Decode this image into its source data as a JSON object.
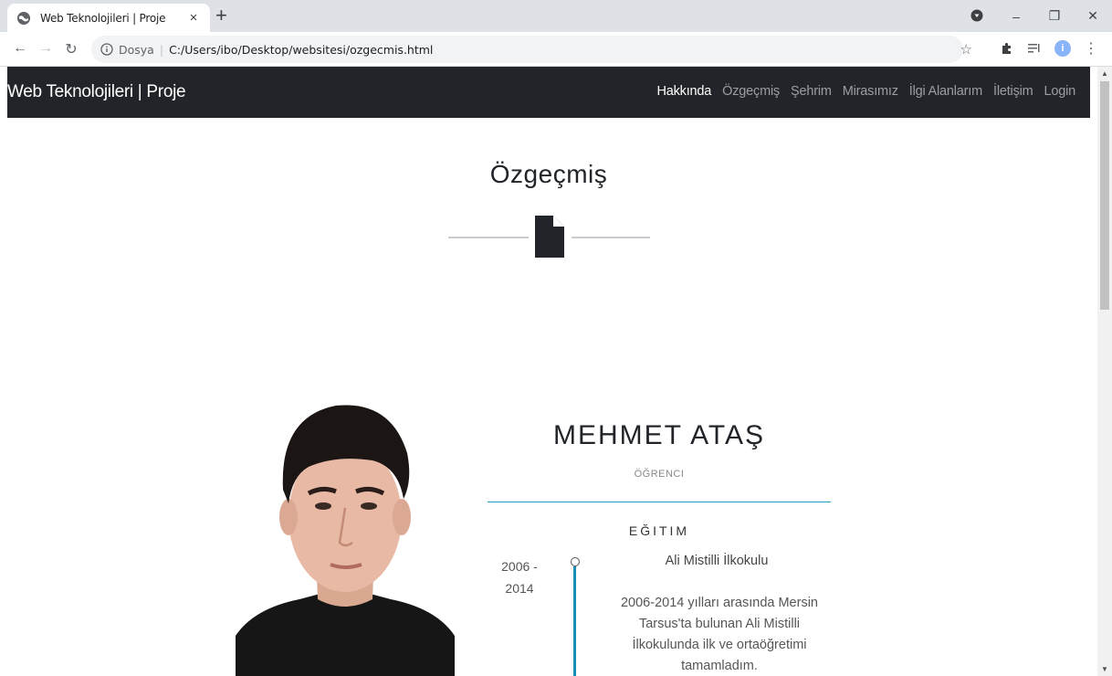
{
  "browser": {
    "tab_title": "Web Teknolojileri | Proje",
    "tab_close": "×",
    "new_tab": "+",
    "address_scheme": "Dosya",
    "address_url": "C:/Users/ibo/Desktop/websitesi/ozgecmis.html",
    "avatar_letter": "i"
  },
  "navbar": {
    "brand": "Web Teknolojileri | Proje",
    "links": [
      "Hakkında",
      "Özgeçmiş",
      "Şehrim",
      "Mirasımız",
      "İlgi Alanlarım",
      "İletişim",
      "Login"
    ]
  },
  "section": {
    "title": "Özgeçmiş"
  },
  "profile": {
    "name": "MEHMET ATAŞ",
    "role": "ÖĞRENCI"
  },
  "education": {
    "heading": "EĞITIM",
    "years_start": "2006 -",
    "years_end": "2014",
    "school": "Ali Mistilli İlkokulu",
    "description": "2006-2014 yılları arasında Mersin Tarsus'ta bulunan Ali Mistilli İlkokulunda ilk ve ortaöğretimi tamamladım."
  },
  "colors": {
    "navbar_bg": "#212529",
    "accent": "#17a2b8"
  }
}
